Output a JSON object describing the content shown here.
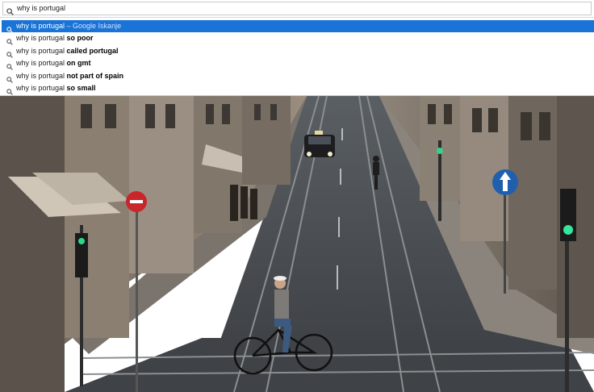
{
  "search": {
    "value": "why is portugal",
    "icon": "search-icon"
  },
  "suggestions": [
    {
      "prefix": "why is portugal",
      "bold": "",
      "suffix": " – Google Iskanje",
      "selected": true
    },
    {
      "prefix": "why is portugal ",
      "bold": "so poor",
      "suffix": "",
      "selected": false
    },
    {
      "prefix": "why is portugal ",
      "bold": "called portugal",
      "suffix": "",
      "selected": false
    },
    {
      "prefix": "why is portugal ",
      "bold": "on gmt",
      "suffix": "",
      "selected": false
    },
    {
      "prefix": "why is portugal ",
      "bold": "not part of spain",
      "suffix": "",
      "selected": false
    },
    {
      "prefix": "why is portugal ",
      "bold": "so small",
      "suffix": "",
      "selected": false
    }
  ],
  "colors": {
    "selection": "#1a73d6",
    "road": "#3e4247",
    "building_left": "#8a7e70",
    "building_right": "#7a7166"
  }
}
